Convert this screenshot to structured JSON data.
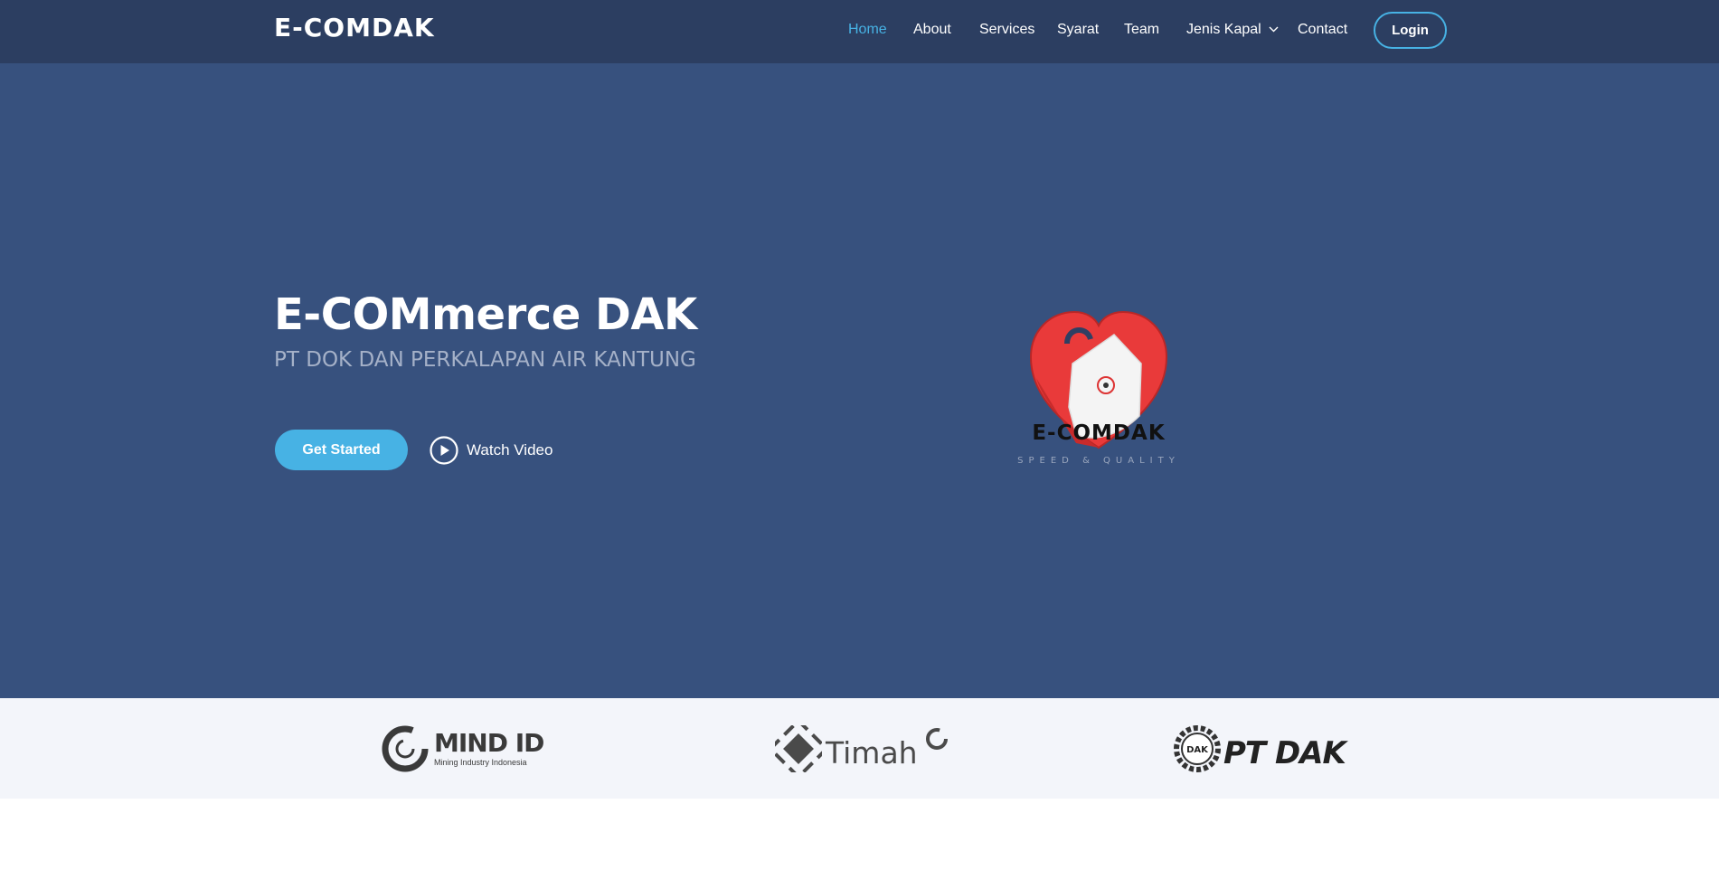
{
  "header": {
    "logo": "E-COMDAK",
    "nav": [
      {
        "label": "Home",
        "active": true
      },
      {
        "label": "About"
      },
      {
        "label": "Services"
      },
      {
        "label": "Syarat"
      },
      {
        "label": "Team"
      },
      {
        "label": "Jenis Kapal",
        "has_dropdown": true
      },
      {
        "label": "Contact"
      }
    ],
    "login_label": "Login"
  },
  "hero": {
    "title": "E-COMmerce DAK",
    "subtitle": "PT DOK DAN PERKALAPAN AIR KANTUNG",
    "get_started": "Get Started",
    "watch_video": "Watch Video",
    "logo_word": "E-COMDAK",
    "logo_tagline": "SPEED & QUALITY"
  },
  "clients": {
    "mind": {
      "name": "MIND ID",
      "tagline": "Mining Industry Indonesia"
    },
    "timah": {
      "name": "Timah"
    },
    "dak": {
      "name": "PT DAK",
      "badge": "DAK"
    }
  },
  "colors": {
    "header_bg": "#2c3e61",
    "hero_bg": "#37517e",
    "accent": "#47b2e4",
    "clients_bg": "#f3f5fa"
  }
}
